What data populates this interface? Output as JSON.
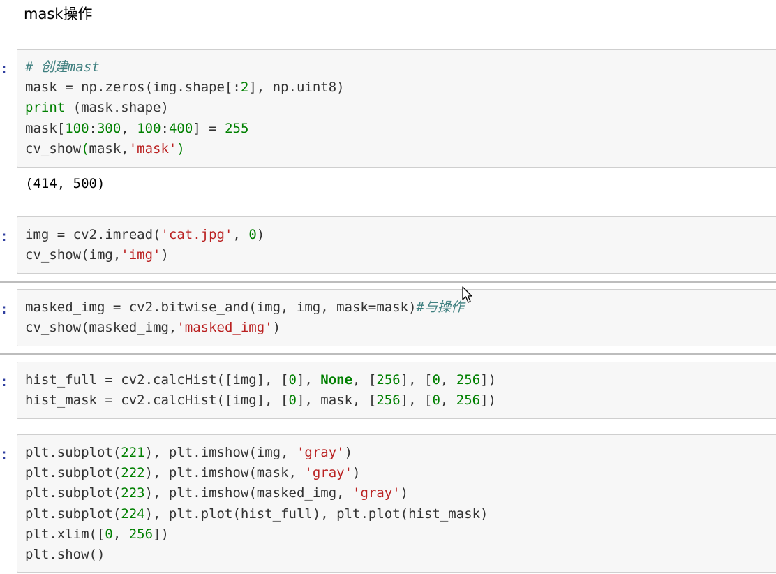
{
  "heading": "mask操作",
  "prompt_char": ":",
  "cells": [
    {
      "id": "cell-1",
      "lines": [
        [
          {
            "t": "# 创建mast",
            "c": "cm"
          }
        ],
        [
          {
            "t": "mask = np.zeros(img.shape[:",
            "c": ""
          },
          {
            "t": "2",
            "c": "num"
          },
          {
            "t": "], np.uint8)",
            "c": ""
          }
        ],
        [
          {
            "t": "print",
            "c": "kw"
          },
          {
            "t": " (mask.shape)",
            "c": ""
          }
        ],
        [
          {
            "t": "mask[",
            "c": ""
          },
          {
            "t": "100",
            "c": "num"
          },
          {
            "t": ":",
            "c": ""
          },
          {
            "t": "300",
            "c": "num"
          },
          {
            "t": ", ",
            "c": ""
          },
          {
            "t": "100",
            "c": "num"
          },
          {
            "t": ":",
            "c": ""
          },
          {
            "t": "400",
            "c": "num"
          },
          {
            "t": "] = ",
            "c": ""
          },
          {
            "t": "255",
            "c": "num"
          }
        ],
        [
          {
            "t": "cv_show",
            "c": ""
          },
          {
            "t": "(",
            "c": "br"
          },
          {
            "t": "mask,",
            "c": ""
          },
          {
            "t": "'mask'",
            "c": "str"
          },
          {
            "t": ")",
            "c": "br"
          }
        ]
      ],
      "output": "(414, 500)"
    },
    {
      "id": "cell-2",
      "lines": [
        [
          {
            "t": "img = cv2.imread(",
            "c": ""
          },
          {
            "t": "'cat.jpg'",
            "c": "str"
          },
          {
            "t": ", ",
            "c": ""
          },
          {
            "t": "0",
            "c": "num"
          },
          {
            "t": ")",
            "c": ""
          }
        ],
        [
          {
            "t": "cv_show(img,",
            "c": ""
          },
          {
            "t": "'img'",
            "c": "str"
          },
          {
            "t": ")",
            "c": ""
          }
        ]
      ]
    },
    {
      "id": "cell-3",
      "lines": [
        [
          {
            "t": "masked_img = cv2.bitwise_and(img, img, mask=mask)",
            "c": ""
          },
          {
            "t": "#与操作",
            "c": "cm"
          }
        ],
        [
          {
            "t": "cv_show(masked_img,",
            "c": ""
          },
          {
            "t": "'masked_img'",
            "c": "str"
          },
          {
            "t": ")",
            "c": ""
          }
        ]
      ]
    },
    {
      "id": "cell-4",
      "lines": [
        [
          {
            "t": "hist_full = cv2.calcHist([img], [",
            "c": ""
          },
          {
            "t": "0",
            "c": "num"
          },
          {
            "t": "], ",
            "c": ""
          },
          {
            "t": "None",
            "c": "kwb"
          },
          {
            "t": ", [",
            "c": ""
          },
          {
            "t": "256",
            "c": "num"
          },
          {
            "t": "], [",
            "c": ""
          },
          {
            "t": "0",
            "c": "num"
          },
          {
            "t": ", ",
            "c": ""
          },
          {
            "t": "256",
            "c": "num"
          },
          {
            "t": "])",
            "c": ""
          }
        ],
        [
          {
            "t": "hist_mask = cv2.calcHist([img], [",
            "c": ""
          },
          {
            "t": "0",
            "c": "num"
          },
          {
            "t": "], mask, [",
            "c": ""
          },
          {
            "t": "256",
            "c": "num"
          },
          {
            "t": "], [",
            "c": ""
          },
          {
            "t": "0",
            "c": "num"
          },
          {
            "t": ", ",
            "c": ""
          },
          {
            "t": "256",
            "c": "num"
          },
          {
            "t": "])",
            "c": ""
          }
        ]
      ]
    },
    {
      "id": "cell-5",
      "lines": [
        [
          {
            "t": "plt.subplot(",
            "c": ""
          },
          {
            "t": "221",
            "c": "num"
          },
          {
            "t": "), plt.imshow(img, ",
            "c": ""
          },
          {
            "t": "'gray'",
            "c": "str"
          },
          {
            "t": ")",
            "c": ""
          }
        ],
        [
          {
            "t": "plt.subplot(",
            "c": ""
          },
          {
            "t": "222",
            "c": "num"
          },
          {
            "t": "), plt.imshow(mask, ",
            "c": ""
          },
          {
            "t": "'gray'",
            "c": "str"
          },
          {
            "t": ")",
            "c": ""
          }
        ],
        [
          {
            "t": "plt.subplot(",
            "c": ""
          },
          {
            "t": "223",
            "c": "num"
          },
          {
            "t": "), plt.imshow(masked_img, ",
            "c": ""
          },
          {
            "t": "'gray'",
            "c": "str"
          },
          {
            "t": ")",
            "c": ""
          }
        ],
        [
          {
            "t": "plt.subplot(",
            "c": ""
          },
          {
            "t": "224",
            "c": "num"
          },
          {
            "t": "), plt.plot(hist_full), plt.plot(hist_mask)",
            "c": ""
          }
        ],
        [
          {
            "t": "plt.xlim([",
            "c": ""
          },
          {
            "t": "0",
            "c": "num"
          },
          {
            "t": ", ",
            "c": ""
          },
          {
            "t": "256",
            "c": "num"
          },
          {
            "t": "])",
            "c": ""
          }
        ],
        [
          {
            "t": "plt.show()",
            "c": ""
          }
        ]
      ]
    }
  ]
}
